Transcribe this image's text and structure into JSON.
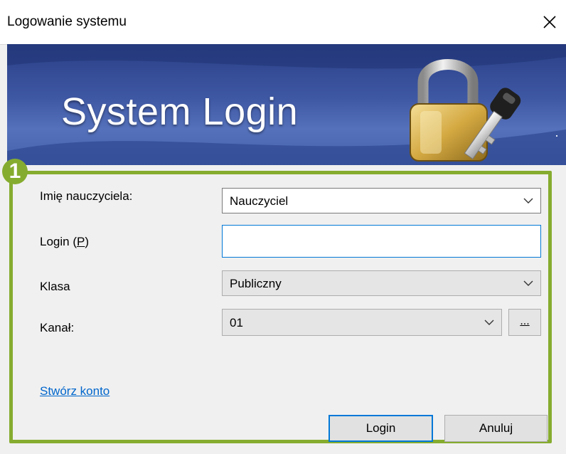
{
  "window": {
    "title": "Logowanie systemu"
  },
  "banner": {
    "title": "System Login"
  },
  "badge": "1",
  "form": {
    "teacher_label": "Imię nauczyciela:",
    "teacher_value": "Nauczyciel",
    "login_label_prefix": "Login (",
    "login_label_key": "P",
    "login_label_suffix": ")",
    "login_value": "",
    "class_label": "Klasa",
    "class_value": "Publiczny",
    "channel_label": "Kanał:",
    "channel_value": "01",
    "browse_label": "...",
    "create_account_link": "Stwórz konto"
  },
  "buttons": {
    "login": "Login",
    "cancel": "Anuluj"
  },
  "colors": {
    "highlight": "#86ac2f",
    "focus": "#0078d7",
    "link": "#0066cc",
    "banner": "#3f58a4"
  },
  "icons": [
    "close-icon",
    "padlock-key-icon",
    "chevron-down-icon"
  ]
}
